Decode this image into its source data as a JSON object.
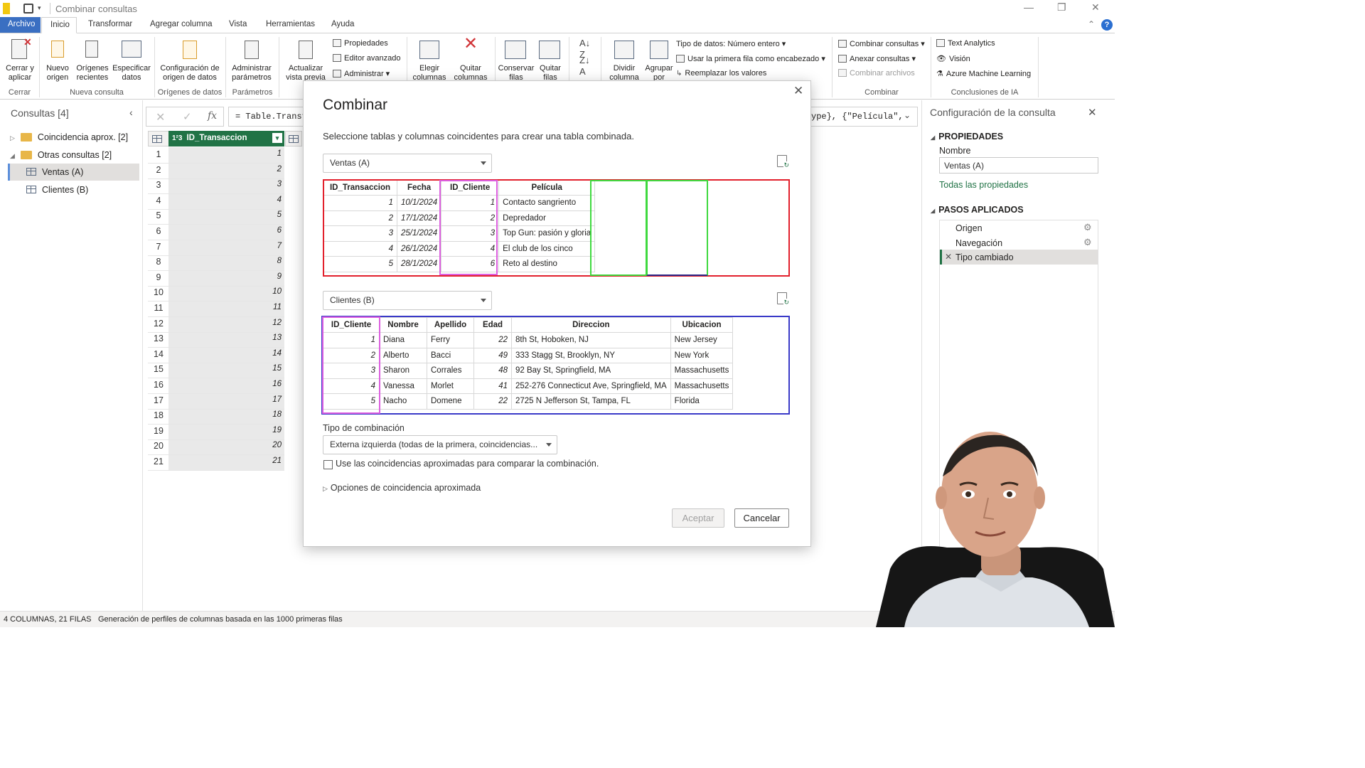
{
  "window": {
    "title": "Combinar consultas"
  },
  "menu": {
    "file": "Archivo",
    "tabs": [
      "Inicio",
      "Transformar",
      "Agregar columna",
      "Vista",
      "Herramientas",
      "Ayuda"
    ]
  },
  "ribbon": {
    "close_apply": [
      "Cerrar y",
      "aplicar"
    ],
    "new_source": [
      "Nuevo",
      "origen"
    ],
    "recent_sources": [
      "Orígenes",
      "recientes"
    ],
    "enter_data": [
      "Especificar",
      "datos"
    ],
    "source_settings": [
      "Configuración de",
      "origen de datos"
    ],
    "manage_params": [
      "Administrar",
      "parámetros"
    ],
    "refresh": [
      "Actualizar",
      "vista previa"
    ],
    "properties": "Propiedades",
    "advanced_editor": "Editor avanzado",
    "manage": "Administrar",
    "choose_cols": [
      "Elegir",
      "columnas"
    ],
    "remove_cols": [
      "Quitar",
      "columnas"
    ],
    "keep_rows": [
      "Conservar",
      "filas"
    ],
    "remove_rows": [
      "Quitar",
      "filas"
    ],
    "split_col": [
      "Dividir",
      "columna"
    ],
    "group_by": [
      "Agrupar",
      "por"
    ],
    "data_type": "Tipo de datos: Número entero",
    "first_row_header": "Usar la primera fila como encabezado",
    "replace_values": "Reemplazar los valores",
    "merge_queries": "Combinar consultas",
    "append_queries": "Anexar consultas",
    "combine_files": "Combinar archivos",
    "text_analytics": "Text Analytics",
    "vision": "Visión",
    "azure_ml": "Azure Machine Learning",
    "groups": [
      "Cerrar",
      "Nueva consulta",
      "Orígenes de datos",
      "Parámetros",
      "Combinar",
      "Conclusiones de IA"
    ]
  },
  "queries": {
    "header": "Consultas [4]",
    "items": [
      {
        "label": "Coincidencia aprox. [2]"
      },
      {
        "label": "Otras consultas [2]"
      },
      {
        "label": "Ventas (A)"
      },
      {
        "label": "Clientes (B)"
      }
    ]
  },
  "formula": {
    "text": "= Table.Transf",
    "tail": "ype}, {\"Película\","
  },
  "grid": {
    "column": "ID_Transaccion",
    "rows": [
      "1",
      "2",
      "3",
      "4",
      "5",
      "6",
      "7",
      "8",
      "9",
      "10",
      "11",
      "12",
      "13",
      "14",
      "15",
      "16",
      "17",
      "18",
      "19",
      "20",
      "21"
    ]
  },
  "dialog": {
    "title": "Combinar",
    "description": "Seleccione tablas y columnas coincidentes para crear una tabla combinada.",
    "table_a": "Ventas (A)",
    "table_b": "Clientes (B)",
    "ventas_cols": [
      "ID_Transaccion",
      "Fecha",
      "ID_Cliente",
      "Película"
    ],
    "ventas_rows": [
      [
        "1",
        "10/1/2024",
        "1",
        "Contacto sangriento"
      ],
      [
        "2",
        "17/1/2024",
        "2",
        "Depredador"
      ],
      [
        "3",
        "25/1/2024",
        "3",
        "Top Gun: pasión y gloria"
      ],
      [
        "4",
        "26/1/2024",
        "4",
        "El club de los cinco"
      ],
      [
        "5",
        "28/1/2024",
        "6",
        "Reto al destino"
      ]
    ],
    "clientes_cols": [
      "ID_Cliente",
      "Nombre",
      "Apellido",
      "Edad",
      "Direccion",
      "Ubicacion"
    ],
    "clientes_rows": [
      [
        "1",
        "Diana",
        "Ferry",
        "22",
        "8th St, Hoboken, NJ",
        "New Jersey"
      ],
      [
        "2",
        "Alberto",
        "Bacci",
        "49",
        "333 Stagg St, Brooklyn, NY",
        "New York"
      ],
      [
        "3",
        "Sharon",
        "Corrales",
        "48",
        "92 Bay St, Springfield, MA",
        "Massachusetts"
      ],
      [
        "4",
        "Vanessa",
        "Morlet",
        "41",
        "252-276 Connecticut Ave, Springfield, MA",
        "Massachusetts"
      ],
      [
        "5",
        "Nacho",
        "Domene",
        "22",
        "2725 N Jefferson St, Tampa, FL",
        "Florida"
      ]
    ],
    "join_type_label": "Tipo de combinación",
    "join_type_value": "Externa izquierda (todas de la primera, coincidencias...",
    "fuzzy_checkbox": "Use las coincidencias aproximadas para comparar la combinación.",
    "fuzzy_options": "Opciones de coincidencia aproximada",
    "ok": "Aceptar",
    "cancel": "Cancelar"
  },
  "settings": {
    "title": "Configuración de la consulta",
    "properties": "PROPIEDADES",
    "name_label": "Nombre",
    "name_value": "Ventas (A)",
    "all_properties": "Todas las propiedades",
    "steps_header": "PASOS APLICADOS",
    "steps": [
      "Origen",
      "Navegación",
      "Tipo cambiado"
    ]
  },
  "status": {
    "counts": "4 COLUMNAS, 21 FILAS",
    "profiling": "Generación de perfiles de columnas basada en las 1000 primeras filas"
  }
}
